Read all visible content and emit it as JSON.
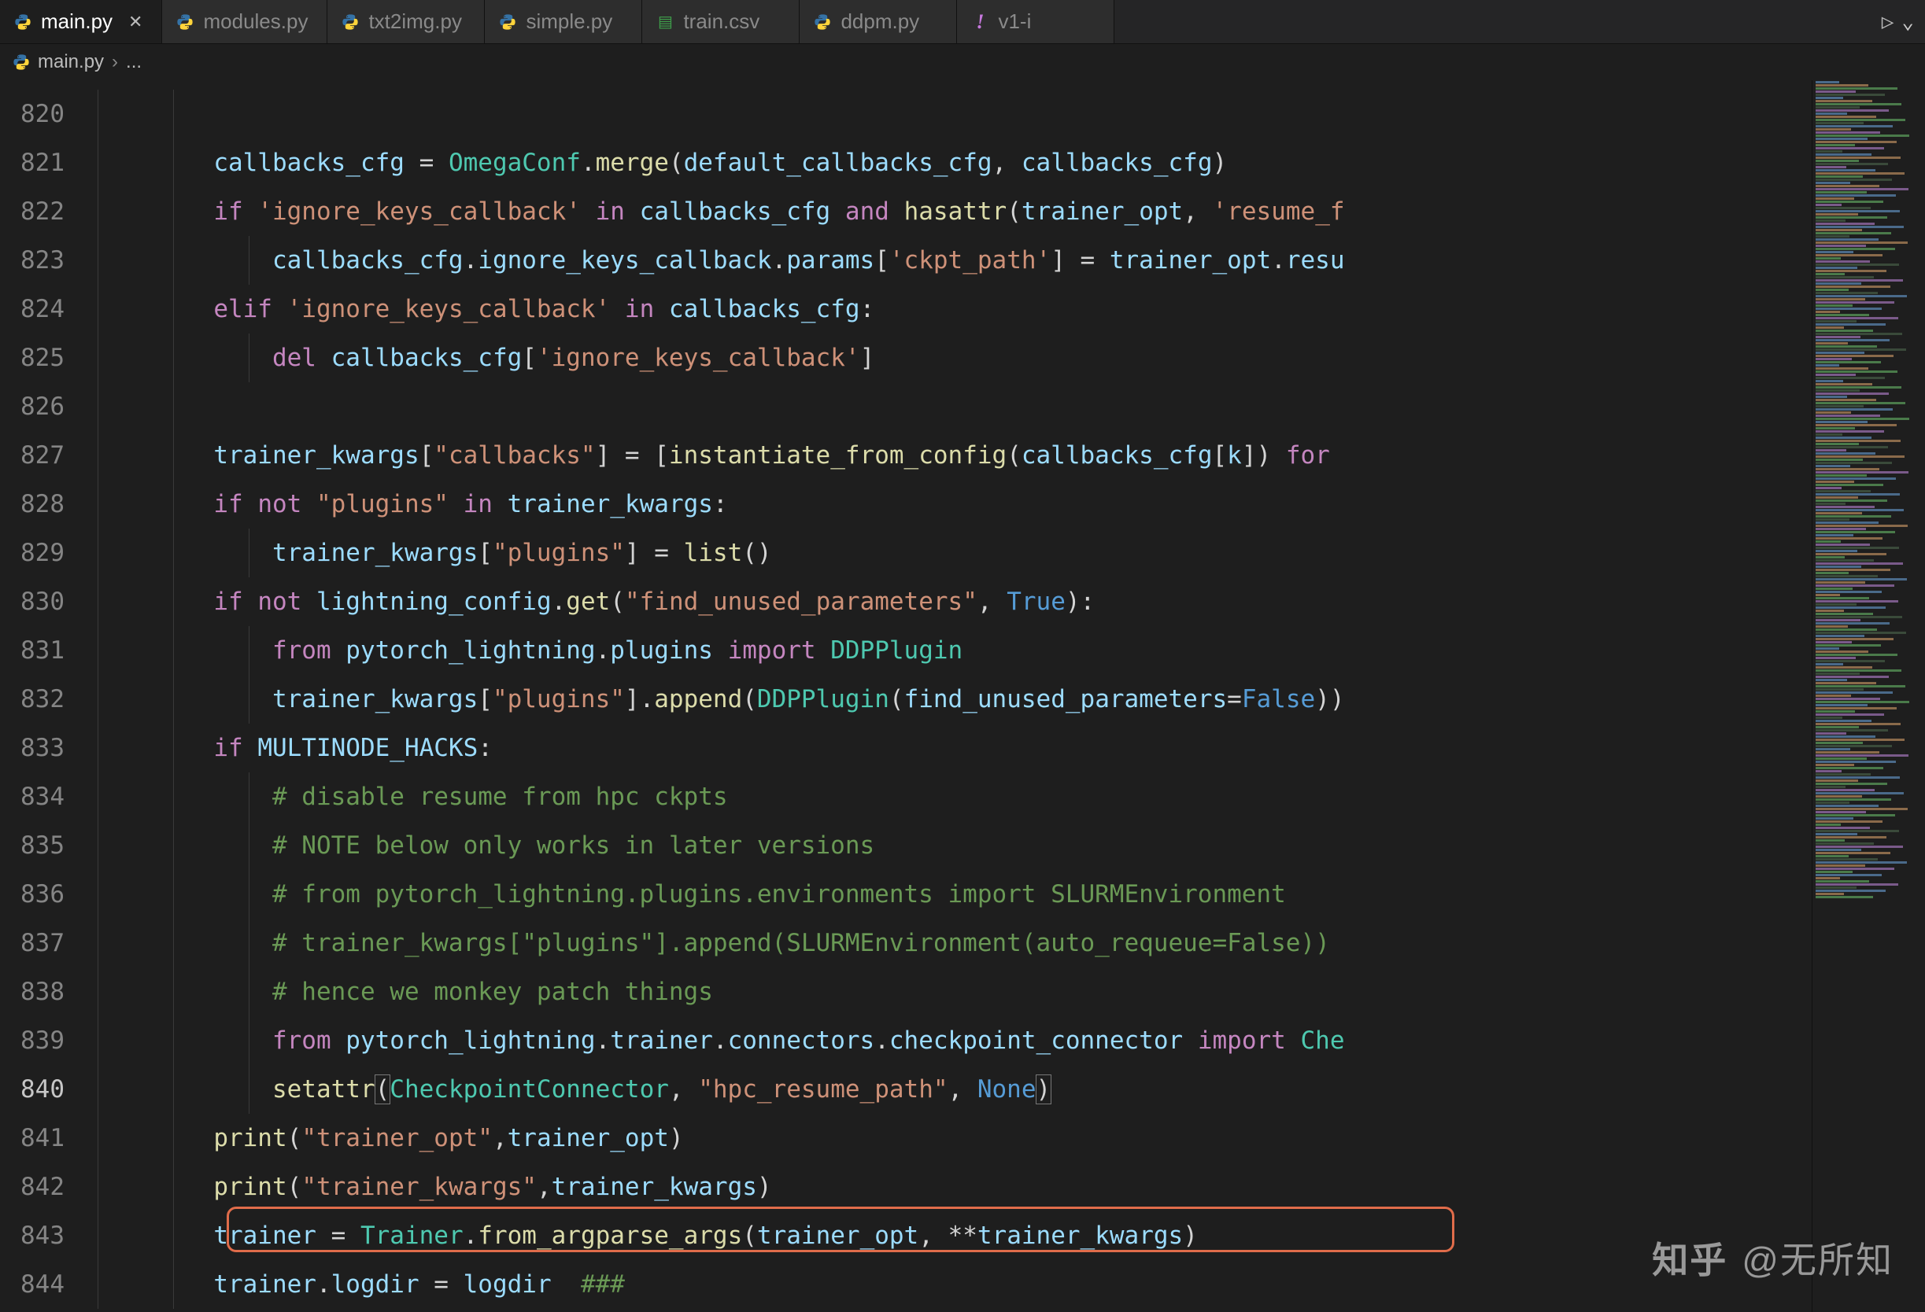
{
  "tabs": [
    {
      "label": "main.py",
      "icon": "python",
      "active": true,
      "closeable": true
    },
    {
      "label": "modules.py",
      "icon": "python",
      "active": false,
      "closeable": false
    },
    {
      "label": "txt2img.py",
      "icon": "python",
      "active": false,
      "closeable": false
    },
    {
      "label": "simple.py",
      "icon": "python",
      "active": false,
      "closeable": false
    },
    {
      "label": "train.csv",
      "icon": "csv",
      "active": false,
      "closeable": false
    },
    {
      "label": "ddpm.py",
      "icon": "python",
      "active": false,
      "closeable": false
    },
    {
      "label": "v1-i",
      "icon": "exclaim",
      "active": false,
      "closeable": false
    }
  ],
  "run_controls": {
    "run": "▷",
    "more": "⌄"
  },
  "breadcrumb": {
    "icon": "python",
    "file": "main.py",
    "sep": "›",
    "tail": "..."
  },
  "line_numbers": [
    "820",
    "821",
    "822",
    "823",
    "824",
    "825",
    "826",
    "827",
    "828",
    "829",
    "830",
    "831",
    "832",
    "833",
    "834",
    "835",
    "836",
    "837",
    "838",
    "839",
    "840",
    "841",
    "842",
    "843",
    "844"
  ],
  "active_line": "840",
  "highlight_box_line": "843",
  "code": {
    "820": [],
    "821": [
      {
        "t": "var",
        "s": "callbacks_cfg"
      },
      {
        "t": "op",
        "s": " = "
      },
      {
        "t": "cls",
        "s": "OmegaConf"
      },
      {
        "t": "pun",
        "s": "."
      },
      {
        "t": "fn",
        "s": "merge"
      },
      {
        "t": "pun",
        "s": "("
      },
      {
        "t": "var",
        "s": "default_callbacks_cfg"
      },
      {
        "t": "pun",
        "s": ", "
      },
      {
        "t": "var",
        "s": "callbacks_cfg"
      },
      {
        "t": "pun",
        "s": ")"
      }
    ],
    "822": [
      {
        "t": "kw1",
        "s": "if"
      },
      {
        "t": "op",
        "s": " "
      },
      {
        "t": "str",
        "s": "'ignore_keys_callback'"
      },
      {
        "t": "op",
        "s": " "
      },
      {
        "t": "kw1",
        "s": "in"
      },
      {
        "t": "op",
        "s": " "
      },
      {
        "t": "var",
        "s": "callbacks_cfg"
      },
      {
        "t": "op",
        "s": " "
      },
      {
        "t": "kw1",
        "s": "and"
      },
      {
        "t": "op",
        "s": " "
      },
      {
        "t": "fn",
        "s": "hasattr"
      },
      {
        "t": "pun",
        "s": "("
      },
      {
        "t": "var",
        "s": "trainer_opt"
      },
      {
        "t": "pun",
        "s": ", "
      },
      {
        "t": "str",
        "s": "'resume_f"
      }
    ],
    "823": [
      {
        "t": "var",
        "s": "callbacks_cfg"
      },
      {
        "t": "pun",
        "s": "."
      },
      {
        "t": "var",
        "s": "ignore_keys_callback"
      },
      {
        "t": "pun",
        "s": "."
      },
      {
        "t": "var",
        "s": "params"
      },
      {
        "t": "pun",
        "s": "["
      },
      {
        "t": "str",
        "s": "'ckpt_path'"
      },
      {
        "t": "pun",
        "s": "] = "
      },
      {
        "t": "var",
        "s": "trainer_opt"
      },
      {
        "t": "pun",
        "s": "."
      },
      {
        "t": "var",
        "s": "resu"
      }
    ],
    "824": [
      {
        "t": "kw1",
        "s": "elif"
      },
      {
        "t": "op",
        "s": " "
      },
      {
        "t": "str",
        "s": "'ignore_keys_callback'"
      },
      {
        "t": "op",
        "s": " "
      },
      {
        "t": "kw1",
        "s": "in"
      },
      {
        "t": "op",
        "s": " "
      },
      {
        "t": "var",
        "s": "callbacks_cfg"
      },
      {
        "t": "pun",
        "s": ":"
      }
    ],
    "825": [
      {
        "t": "kw1",
        "s": "del"
      },
      {
        "t": "op",
        "s": " "
      },
      {
        "t": "var",
        "s": "callbacks_cfg"
      },
      {
        "t": "pun",
        "s": "["
      },
      {
        "t": "str",
        "s": "'ignore_keys_callback'"
      },
      {
        "t": "pun",
        "s": "]"
      }
    ],
    "826": [],
    "827": [
      {
        "t": "var",
        "s": "trainer_kwargs"
      },
      {
        "t": "pun",
        "s": "["
      },
      {
        "t": "str",
        "s": "\"callbacks\""
      },
      {
        "t": "pun",
        "s": "] = ["
      },
      {
        "t": "fn",
        "s": "instantiate_from_config"
      },
      {
        "t": "pun",
        "s": "("
      },
      {
        "t": "var",
        "s": "callbacks_cfg"
      },
      {
        "t": "pun",
        "s": "["
      },
      {
        "t": "var",
        "s": "k"
      },
      {
        "t": "pun",
        "s": "]) "
      },
      {
        "t": "kw1",
        "s": "for"
      }
    ],
    "828": [
      {
        "t": "kw1",
        "s": "if"
      },
      {
        "t": "op",
        "s": " "
      },
      {
        "t": "kw1",
        "s": "not"
      },
      {
        "t": "op",
        "s": " "
      },
      {
        "t": "str",
        "s": "\"plugins\""
      },
      {
        "t": "op",
        "s": " "
      },
      {
        "t": "kw1",
        "s": "in"
      },
      {
        "t": "op",
        "s": " "
      },
      {
        "t": "var",
        "s": "trainer_kwargs"
      },
      {
        "t": "pun",
        "s": ":"
      }
    ],
    "829": [
      {
        "t": "var",
        "s": "trainer_kwargs"
      },
      {
        "t": "pun",
        "s": "["
      },
      {
        "t": "str",
        "s": "\"plugins\""
      },
      {
        "t": "pun",
        "s": "] = "
      },
      {
        "t": "fn",
        "s": "list"
      },
      {
        "t": "pun",
        "s": "()"
      }
    ],
    "830": [
      {
        "t": "kw1",
        "s": "if"
      },
      {
        "t": "op",
        "s": " "
      },
      {
        "t": "kw1",
        "s": "not"
      },
      {
        "t": "op",
        "s": " "
      },
      {
        "t": "var",
        "s": "lightning_config"
      },
      {
        "t": "pun",
        "s": "."
      },
      {
        "t": "fn",
        "s": "get"
      },
      {
        "t": "pun",
        "s": "("
      },
      {
        "t": "str",
        "s": "\"find_unused_parameters\""
      },
      {
        "t": "pun",
        "s": ", "
      },
      {
        "t": "kw2",
        "s": "True"
      },
      {
        "t": "pun",
        "s": "):"
      }
    ],
    "831": [
      {
        "t": "kw1",
        "s": "from"
      },
      {
        "t": "op",
        "s": " "
      },
      {
        "t": "var",
        "s": "pytorch_lightning"
      },
      {
        "t": "pun",
        "s": "."
      },
      {
        "t": "var",
        "s": "plugins"
      },
      {
        "t": "op",
        "s": " "
      },
      {
        "t": "kw1",
        "s": "import"
      },
      {
        "t": "op",
        "s": " "
      },
      {
        "t": "cls",
        "s": "DDPPlugin"
      }
    ],
    "832": [
      {
        "t": "var",
        "s": "trainer_kwargs"
      },
      {
        "t": "pun",
        "s": "["
      },
      {
        "t": "str",
        "s": "\"plugins\""
      },
      {
        "t": "pun",
        "s": "]."
      },
      {
        "t": "fn",
        "s": "append"
      },
      {
        "t": "pun",
        "s": "("
      },
      {
        "t": "cls",
        "s": "DDPPlugin"
      },
      {
        "t": "pun",
        "s": "("
      },
      {
        "t": "var",
        "s": "find_unused_parameters"
      },
      {
        "t": "op",
        "s": "="
      },
      {
        "t": "kw2",
        "s": "False"
      },
      {
        "t": "pun",
        "s": "))"
      }
    ],
    "833": [
      {
        "t": "kw1",
        "s": "if"
      },
      {
        "t": "op",
        "s": " "
      },
      {
        "t": "var",
        "s": "MULTINODE_HACKS"
      },
      {
        "t": "pun",
        "s": ":"
      }
    ],
    "834": [
      {
        "t": "cmt",
        "s": "# disable resume from hpc ckpts"
      }
    ],
    "835": [
      {
        "t": "cmt",
        "s": "# NOTE below only works in later versions"
      }
    ],
    "836": [
      {
        "t": "cmt",
        "s": "# from pytorch_lightning.plugins.environments import SLURMEnvironment"
      }
    ],
    "837": [
      {
        "t": "cmt",
        "s": "# trainer_kwargs[\"plugins\"].append(SLURMEnvironment(auto_requeue=False))"
      }
    ],
    "838": [
      {
        "t": "cmt",
        "s": "# hence we monkey patch things"
      }
    ],
    "839": [
      {
        "t": "kw1",
        "s": "from"
      },
      {
        "t": "op",
        "s": " "
      },
      {
        "t": "var",
        "s": "pytorch_lightning"
      },
      {
        "t": "pun",
        "s": "."
      },
      {
        "t": "var",
        "s": "trainer"
      },
      {
        "t": "pun",
        "s": "."
      },
      {
        "t": "var",
        "s": "connectors"
      },
      {
        "t": "pun",
        "s": "."
      },
      {
        "t": "var",
        "s": "checkpoint_connector"
      },
      {
        "t": "op",
        "s": " "
      },
      {
        "t": "kw1",
        "s": "import"
      },
      {
        "t": "op",
        "s": " "
      },
      {
        "t": "cls",
        "s": "Che"
      }
    ],
    "840": [
      {
        "t": "fn",
        "s": "setattr"
      },
      {
        "t": "pun bracket-match",
        "s": "("
      },
      {
        "t": "cls",
        "s": "CheckpointConnector"
      },
      {
        "t": "pun",
        "s": ", "
      },
      {
        "t": "str",
        "s": "\"hpc_resume_path\""
      },
      {
        "t": "pun",
        "s": ", "
      },
      {
        "t": "kw2",
        "s": "None"
      },
      {
        "t": "pun bracket-match",
        "s": ")"
      }
    ],
    "841": [
      {
        "t": "fn",
        "s": "print"
      },
      {
        "t": "pun",
        "s": "("
      },
      {
        "t": "str",
        "s": "\"trainer_opt\""
      },
      {
        "t": "pun",
        "s": ","
      },
      {
        "t": "var",
        "s": "trainer_opt"
      },
      {
        "t": "pun",
        "s": ")"
      }
    ],
    "842": [
      {
        "t": "fn",
        "s": "print"
      },
      {
        "t": "pun",
        "s": "("
      },
      {
        "t": "str",
        "s": "\"trainer_kwargs\""
      },
      {
        "t": "pun",
        "s": ","
      },
      {
        "t": "var",
        "s": "trainer_kwargs"
      },
      {
        "t": "pun",
        "s": ")"
      }
    ],
    "843": [
      {
        "t": "var",
        "s": "trainer"
      },
      {
        "t": "op",
        "s": " = "
      },
      {
        "t": "cls",
        "s": "Trainer"
      },
      {
        "t": "pun",
        "s": "."
      },
      {
        "t": "fn",
        "s": "from_argparse_args"
      },
      {
        "t": "pun",
        "s": "("
      },
      {
        "t": "var",
        "s": "trainer_opt"
      },
      {
        "t": "pun",
        "s": ", "
      },
      {
        "t": "op",
        "s": "**"
      },
      {
        "t": "var",
        "s": "trainer_kwargs"
      },
      {
        "t": "pun",
        "s": ")"
      }
    ],
    "844": [
      {
        "t": "var",
        "s": "trainer"
      },
      {
        "t": "pun",
        "s": "."
      },
      {
        "t": "var",
        "s": "logdir"
      },
      {
        "t": "op",
        "s": " = "
      },
      {
        "t": "var",
        "s": "logdir"
      },
      {
        "t": "op",
        "s": "  "
      },
      {
        "t": "cmt",
        "s": "###"
      }
    ]
  },
  "indents": {
    "820": 2,
    "821": 2,
    "822": 2,
    "823": 3,
    "824": 2,
    "825": 3,
    "826": 2,
    "827": 2,
    "828": 2,
    "829": 3,
    "830": 2,
    "831": 3,
    "832": 3,
    "833": 2,
    "834": 3,
    "835": 3,
    "836": 3,
    "837": 3,
    "838": 3,
    "839": 3,
    "840": 3,
    "841": 2,
    "842": 2,
    "843": 2,
    "844": 2
  },
  "watermark": {
    "logo": "知乎",
    "text": "@无所知"
  }
}
